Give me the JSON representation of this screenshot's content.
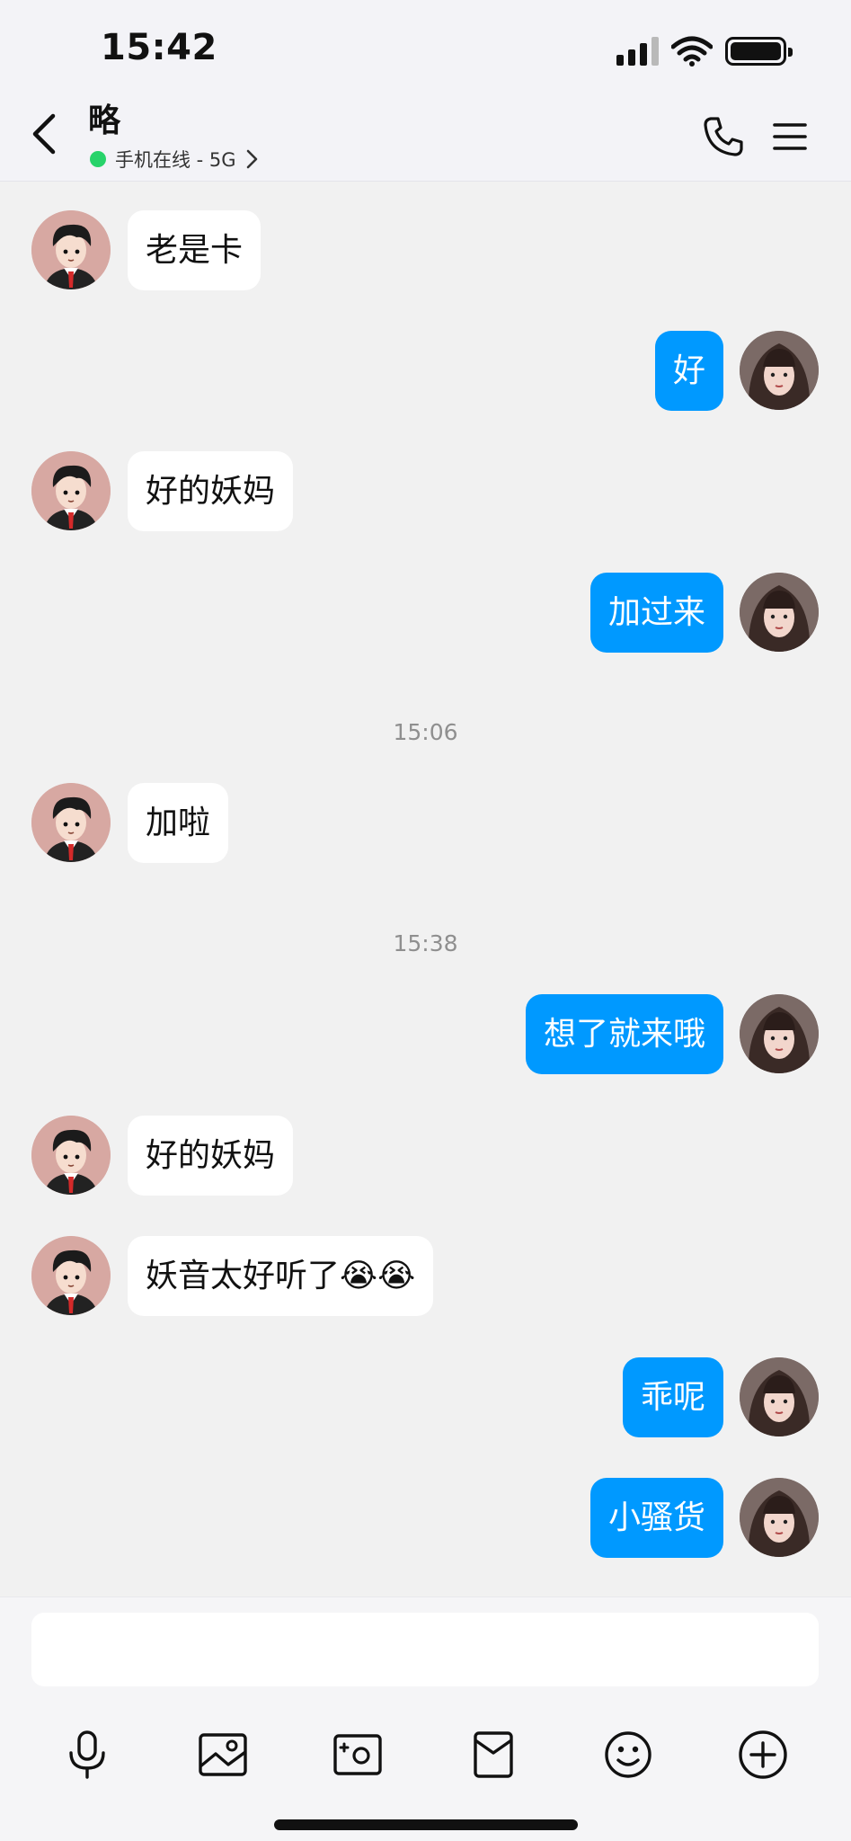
{
  "status_bar": {
    "time": "15:42"
  },
  "header": {
    "contact_name": "略",
    "presence": "手机在线 - 5G",
    "presence_color": "#27d36a"
  },
  "messages": [
    {
      "side": "peer",
      "text": "老是卡"
    },
    {
      "side": "me",
      "text": "好"
    },
    {
      "side": "peer",
      "text": "好的妖妈"
    },
    {
      "side": "me",
      "text": "加过来"
    },
    {
      "type": "time",
      "text": "15:06"
    },
    {
      "side": "peer",
      "text": "加啦"
    },
    {
      "type": "time",
      "text": "15:38"
    },
    {
      "side": "me",
      "text": "想了就来哦"
    },
    {
      "side": "peer",
      "text": "好的妖妈"
    },
    {
      "side": "peer",
      "text": "妖音太好听了😭😭"
    },
    {
      "side": "me",
      "text": "乖呢"
    },
    {
      "side": "me",
      "text": "小骚货"
    }
  ],
  "composer": {
    "input_value": "",
    "tools": [
      "microphone-icon",
      "image-icon",
      "camera-icon",
      "red-packet-icon",
      "emoji-icon",
      "plus-icon"
    ]
  },
  "colors": {
    "my_bubble": "#0099ff",
    "peer_bubble": "#ffffff",
    "background": "#f1f1f1"
  }
}
